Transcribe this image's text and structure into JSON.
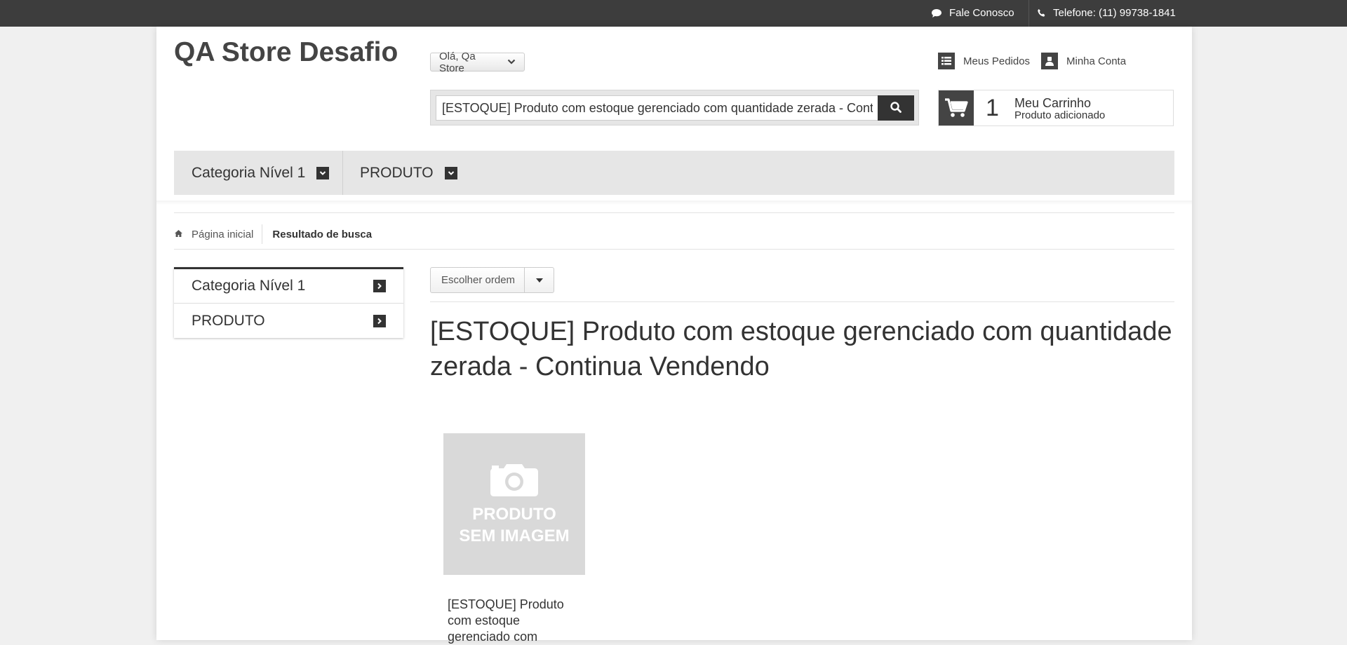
{
  "topbar": {
    "contact_label": "Fale Conosco",
    "phone_label": "Telefone: (11) 99738-1841"
  },
  "header": {
    "logo": "QA Store Desafio",
    "greeting": "Olá, Qa Store",
    "search_value": "[ESTOQUE] Produto com estoque gerenciado com quantidade zerada - Continua Vendendo",
    "orders_label": "Meus Pedidos",
    "account_label": "Minha Conta",
    "cart": {
      "count": "1",
      "title": "Meu Carrinho",
      "subtitle": "Produto adicionado"
    }
  },
  "nav": {
    "items": [
      {
        "label": "Categoria Nível 1"
      },
      {
        "label": "PRODUTO"
      }
    ]
  },
  "breadcrumb": {
    "home": "Página inicial",
    "current": "Resultado de busca"
  },
  "sidebar": {
    "items": [
      {
        "label": "Categoria Nível 1"
      },
      {
        "label": "PRODUTO"
      }
    ]
  },
  "sort": {
    "label": "Escolher ordem"
  },
  "main": {
    "title": "[ESTOQUE] Produto com estoque gerenciado com quantidade zerada - Continua Vendendo"
  },
  "products": [
    {
      "placeholder_line1": "PRODUTO",
      "placeholder_line2": "SEM IMAGEM",
      "name": "[ESTOQUE] Produto com estoque gerenciado com"
    }
  ],
  "icons": {
    "chat": "chat-icon",
    "phone": "phone-icon",
    "list": "list-icon",
    "user": "user-icon",
    "cart": "cart-icon",
    "search": "search-icon",
    "home": "home-icon",
    "camera": "camera-icon"
  }
}
